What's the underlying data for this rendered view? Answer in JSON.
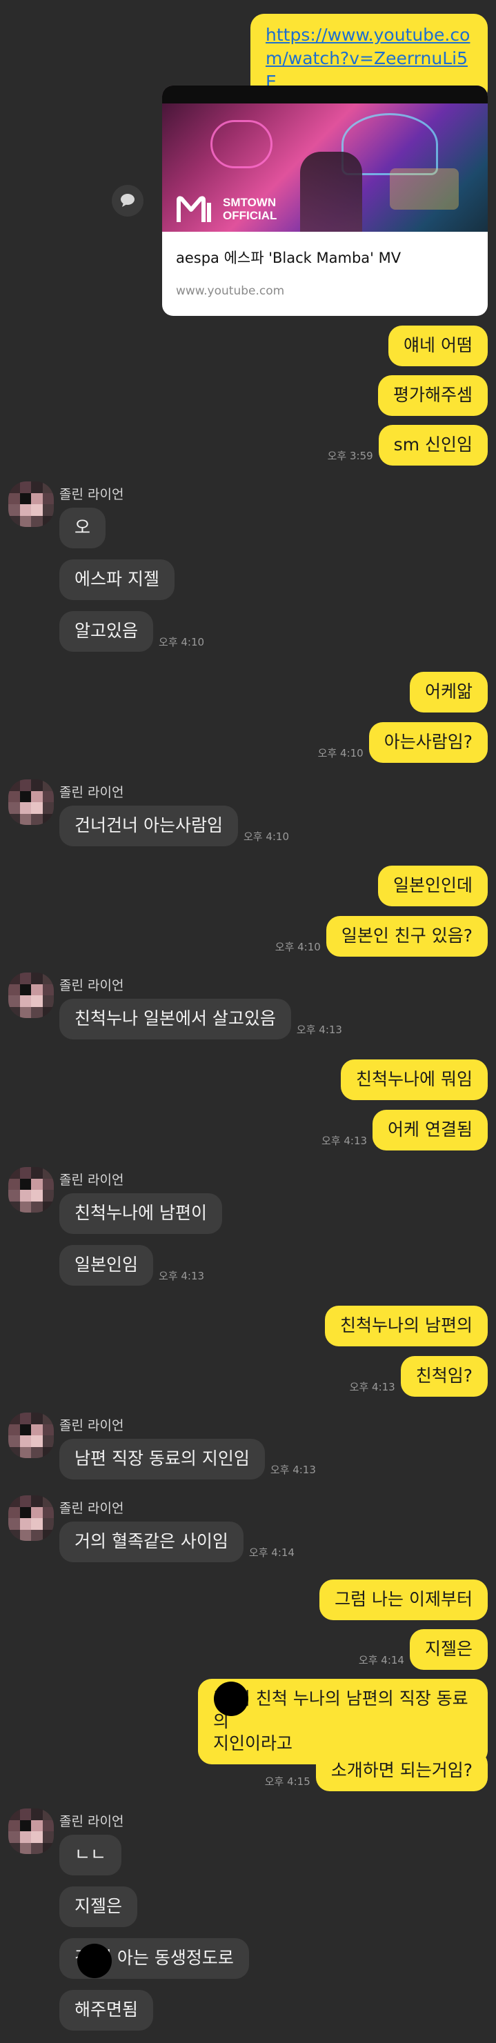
{
  "colors": {
    "background": "#2b2b2b",
    "outgoing_bubble": "#fde434",
    "incoming_bubble": "#3d3d3d",
    "link": "#1d6fcf"
  },
  "link_message": {
    "url": "https://www.youtube.com/watch?v=ZeerrnuLi5E",
    "preview": {
      "brand": "SMTOWN\nOFFICIAL",
      "brand_line1": "SMTOWN",
      "brand_line2": "OFFICIAL",
      "title": "aespa 에스파 'Black Mamba' MV",
      "domain": "www.youtube.com"
    },
    "share_icon": "speech-bubble-icon"
  },
  "sender": {
    "name": "졸린 라이언",
    "avatar_icon": "pixelated-avatar"
  },
  "messages": {
    "m1": "얘네 어떰",
    "m2": "평가해주셈",
    "m3": "sm 신인임",
    "t1": "오후 3:59",
    "m4": "오",
    "m5": "에스파 지젤",
    "m6": "알고있음",
    "t2": "오후 4:10",
    "m7": "어케앎",
    "m8": "아는사람임?",
    "t3": "오후 4:10",
    "m9": "건너건너 아는사람임",
    "t4": "오후 4:10",
    "m10": "일본인인데",
    "m11": "일본인 친구 있음?",
    "t5": "오후 4:10",
    "m12": "친척누나 일본에서 살고있음",
    "t6": "오후 4:13",
    "m13": "친척누나에 뭐임",
    "m14": "어케 연결됨",
    "t7": "오후 4:13",
    "m15": "친척누나에 남편이",
    "m16": "일본인임",
    "t8": "오후 4:13",
    "m17": "친척누나의 남편의",
    "m18": "친척임?",
    "t9": "오후 4:13",
    "m19": "남편 직장 동료의 지인임",
    "t10": "오후 4:13",
    "m20": "거의 혈족같은 사이임",
    "t11": "오후 4:14",
    "m21": "그럼 나는 이제부터",
    "m22": "지젤은",
    "t12": "오후 4:14",
    "m23_line1": "김  의 친척 누나의 남편의 직장 동료의",
    "m23_line2": "지인이라고",
    "m24": "소개하면 되는거임?",
    "t13": "오후 4:15",
    "m25": "ㄴㄴ",
    "m26": "지젤은",
    "m27": "김  의 아는 동생정도로",
    "m28": "해주면됨"
  }
}
